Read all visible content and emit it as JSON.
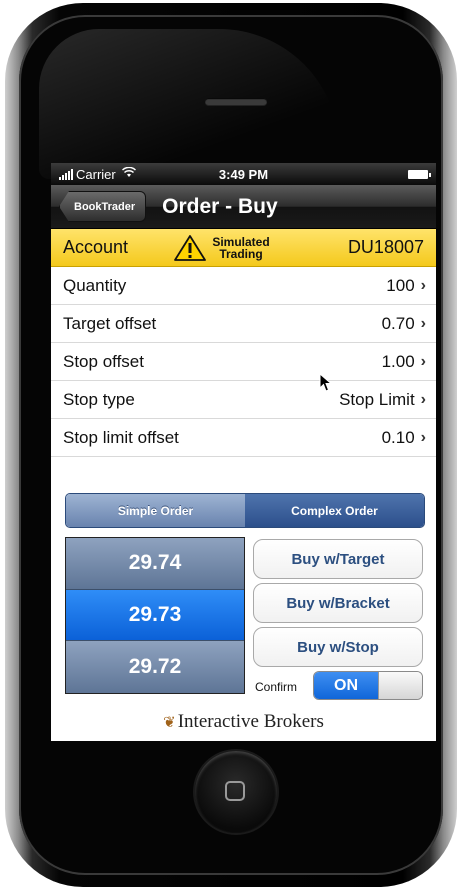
{
  "status_bar": {
    "carrier": "Carrier",
    "time": "3:49 PM"
  },
  "nav": {
    "back_label": "BookTrader",
    "title": "Order - Buy"
  },
  "account": {
    "label": "Account",
    "badge_line1": "Simulated",
    "badge_line2": "Trading",
    "id": "DU18007"
  },
  "rows": [
    {
      "label": "Quantity",
      "value": "100"
    },
    {
      "label": "Target offset",
      "value": "0.70"
    },
    {
      "label": "Stop offset",
      "value": "1.00"
    },
    {
      "label": "Stop type",
      "value": "Stop Limit"
    },
    {
      "label": "Stop limit offset",
      "value": "0.10"
    }
  ],
  "segment": {
    "simple": "Simple Order",
    "complex": "Complex Order"
  },
  "prices": [
    "29.74",
    "29.73",
    "29.72"
  ],
  "buttons": {
    "target": "Buy w/Target",
    "bracket": "Buy w/Bracket",
    "stop": "Buy w/Stop"
  },
  "confirm": {
    "label": "Confirm",
    "state": "ON"
  },
  "brand": "Interactive Brokers",
  "colors": {
    "account_bar": "#f4c91c",
    "selected_price": "#0b61d8",
    "segment_active": "#2c4f8b"
  }
}
